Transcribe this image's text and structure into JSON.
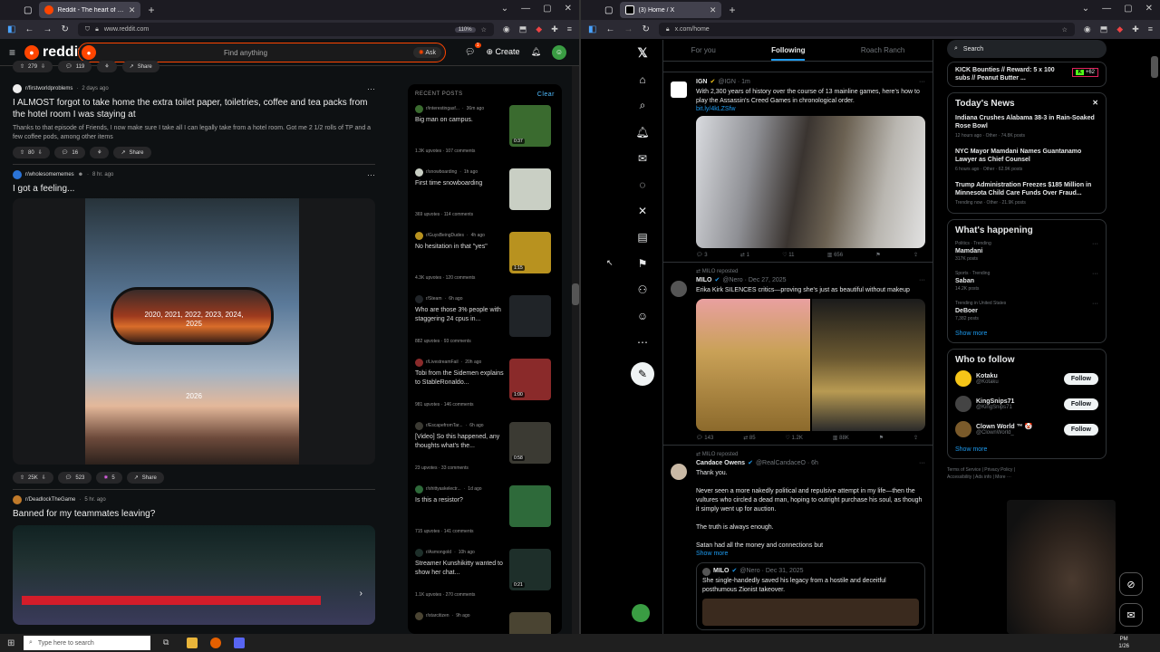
{
  "left_browser": {
    "tab_title": "Reddit - The heart of the intern...",
    "url": "www.reddit.com",
    "zoom": "110%"
  },
  "reddit": {
    "logo": "reddit",
    "search_placeholder": "Find anything",
    "ask": "Ask",
    "create": "Create",
    "chat_badge": "1",
    "top_stub": {
      "votes": "279",
      "comments": "119",
      "share": "Share"
    },
    "posts": [
      {
        "sub": "r/firstworldproblems",
        "time": "2 days ago",
        "title": "I ALMOST forgot to take home the extra toilet paper, toiletries, coffee and tea packs from the hotel room I was staying at",
        "body": "Thanks to that episode of Friends, I now make sure I take all I can legally take from a hotel room. Got me 2 1/2 rolls of TP and a few coffee pods, among other items",
        "votes": "80",
        "comments": "16",
        "share": "Share"
      },
      {
        "sub": "r/wholesomememes",
        "time": "8 hr. ago",
        "title": "I got a feeling...",
        "mirror_text": "2020, 2021, 2022, 2023, 2024, 2025",
        "road_text": "2026",
        "votes": "25K",
        "comments": "523",
        "awards": "5",
        "share": "Share"
      },
      {
        "sub": "r/DeadlockTheGame",
        "time": "5 hr. ago",
        "title": "Banned for my teammates leaving?"
      }
    ],
    "recent": {
      "heading": "RECENT POSTS",
      "clear": "Clear",
      "items": [
        {
          "sub": "r/interestingasf...",
          "time": "36m ago",
          "title": "Big man on campus.",
          "upvotes": "1.3K upvotes",
          "comments": "107 comments",
          "thumb_label": "0:37",
          "color": "#3a6b2f"
        },
        {
          "sub": "r/snowboarding",
          "time": "1h ago",
          "title": "First time snowboarding",
          "upvotes": "369 upvotes",
          "comments": "114 comments",
          "thumb_label": "",
          "color": "#c9cfc4"
        },
        {
          "sub": "r/GuysBeingDudes",
          "time": "4h ago",
          "title": "No hesitation in that \"yes\"",
          "upvotes": "4.3K upvotes",
          "comments": "120 comments",
          "thumb_label": "1:15",
          "color": "#b8921f"
        },
        {
          "sub": "r/Steam",
          "time": "6h ago",
          "title": "Who are those 3% people with staggering 24 cpus in...",
          "upvotes": "882 upvotes",
          "comments": "93 comments",
          "thumb_label": "",
          "color": "#202428"
        },
        {
          "sub": "r/LivestreamFail",
          "time": "20h ago",
          "title": "Tobi from the Sidemen explains to StableRonaldo...",
          "upvotes": "981 upvotes",
          "comments": "146 comments",
          "thumb_label": "1:00",
          "color": "#8a2a2a"
        },
        {
          "sub": "r/EscapefromTar...",
          "time": "6h ago",
          "title": "[Video] So this happened, any thoughts what's the...",
          "upvotes": "23 upvotes",
          "comments": "33 comments",
          "thumb_label": "0:58",
          "color": "#3b3a33"
        },
        {
          "sub": "r/shittyaskelectr...",
          "time": "1d ago",
          "title": "Is this a resistor?",
          "upvotes": "715 upvotes",
          "comments": "141 comments",
          "thumb_label": "",
          "color": "#2e6a3a"
        },
        {
          "sub": "r/Asmongold",
          "time": "10h ago",
          "title": "Streamer Kunshikitty wanted to show her chat...",
          "upvotes": "1.1K upvotes",
          "comments": "270 comments",
          "thumb_label": "0:21",
          "color": "#1e2f2a"
        },
        {
          "sub": "r/starcitizen",
          "time": "9h ago",
          "title": "",
          "upvotes": "",
          "comments": "",
          "thumb_label": "",
          "color": "#4a4432"
        }
      ]
    }
  },
  "right_browser": {
    "tab_title": "(3) Home / X",
    "url": "x.com/home"
  },
  "x": {
    "tabs": [
      "For you",
      "Following",
      "Roach Ranch"
    ],
    "active_tab": "Following",
    "tweets": [
      {
        "name": "IGN",
        "handle": "@IGN · 1m",
        "text": "With 2,300 years of history over the course of 13 mainline games, here's how to play the Assassin's Creed Games in chronological order.",
        "link": "bit.ly/4kLZSfw",
        "reply": "3",
        "retweet": "1",
        "like": "11",
        "views": "656"
      },
      {
        "repost": "MILO reposted",
        "name": "MILO",
        "handle": "@Nero · Dec 27, 2025",
        "text": "Erika Kirk SILENCES critics—proving she's just as beautiful without makeup",
        "reply": "143",
        "retweet": "85",
        "like": "1.2K",
        "views": "88K"
      },
      {
        "repost": "MILO reposted",
        "name": "Candace Owens",
        "handle": "@RealCandaceO · 6h",
        "p1": "Thank you.",
        "p2": "Never seen a more nakedly political and repulsive attempt in my life—then the vultures who circled a dead man, hoping to outright purchase his soul, as though it simply went up for auction.",
        "p3": "The truth is always enough.",
        "p4": "Satan had all the money and connections but",
        "show_more": "Show more",
        "quote_name": "MILO",
        "quote_handle": "@Nero · Dec 31, 2025",
        "quote_text": "She single-handedly saved his legacy from a hostile and deceitful posthumous Zionist takeover."
      }
    ],
    "search": "Search",
    "promo": "KICK Bounties // Reward: 5 x 100 subs // Peanut Butter ...",
    "promo_badge": "+62",
    "news_title": "Today's News",
    "news": [
      {
        "title": "Indiana Crushes Alabama 38-3 in Rain-Soaked Rose Bowl",
        "meta": "12 hours ago · Other · 74.8K posts"
      },
      {
        "title": "NYC Mayor Mamdani Names Guantanamo Lawyer as Chief Counsel",
        "meta": "6 hours ago · Other · 62.9K posts"
      },
      {
        "title": "Trump Administration Freezes $185 Million in Minnesota Child Care Funds Over Fraud...",
        "meta": "Trending now · Other · 21.9K posts"
      }
    ],
    "happening_title": "What's happening",
    "trends": [
      {
        "cat": "Politics · Trending",
        "name": "Mamdani",
        "posts": "317K posts"
      },
      {
        "cat": "Sports · Trending",
        "name": "Saban",
        "posts": "14.2K posts"
      },
      {
        "cat": "Trending in United States",
        "name": "DeBoer",
        "posts": "7,382 posts"
      }
    ],
    "show_more": "Show more",
    "follow_title": "Who to follow",
    "follows": [
      {
        "name": "Kotaku",
        "handle": "@Kotaku",
        "btn": "Follow",
        "color": "#f5c518"
      },
      {
        "name": "KingSnips71",
        "handle": "@KingSnips71",
        "btn": "Follow",
        "color": "#444"
      },
      {
        "name": "Clown World ™ 🤡",
        "handle": "@ClownWorld_",
        "btn": "Follow",
        "color": "#7a5a2a"
      }
    ],
    "footer1": "Terms of Service | Privacy Policy |",
    "footer2": "Accessibility | Ads info | More ···"
  },
  "taskbar": {
    "search": "Type here to search",
    "time": "PM",
    "date": "1/26"
  }
}
